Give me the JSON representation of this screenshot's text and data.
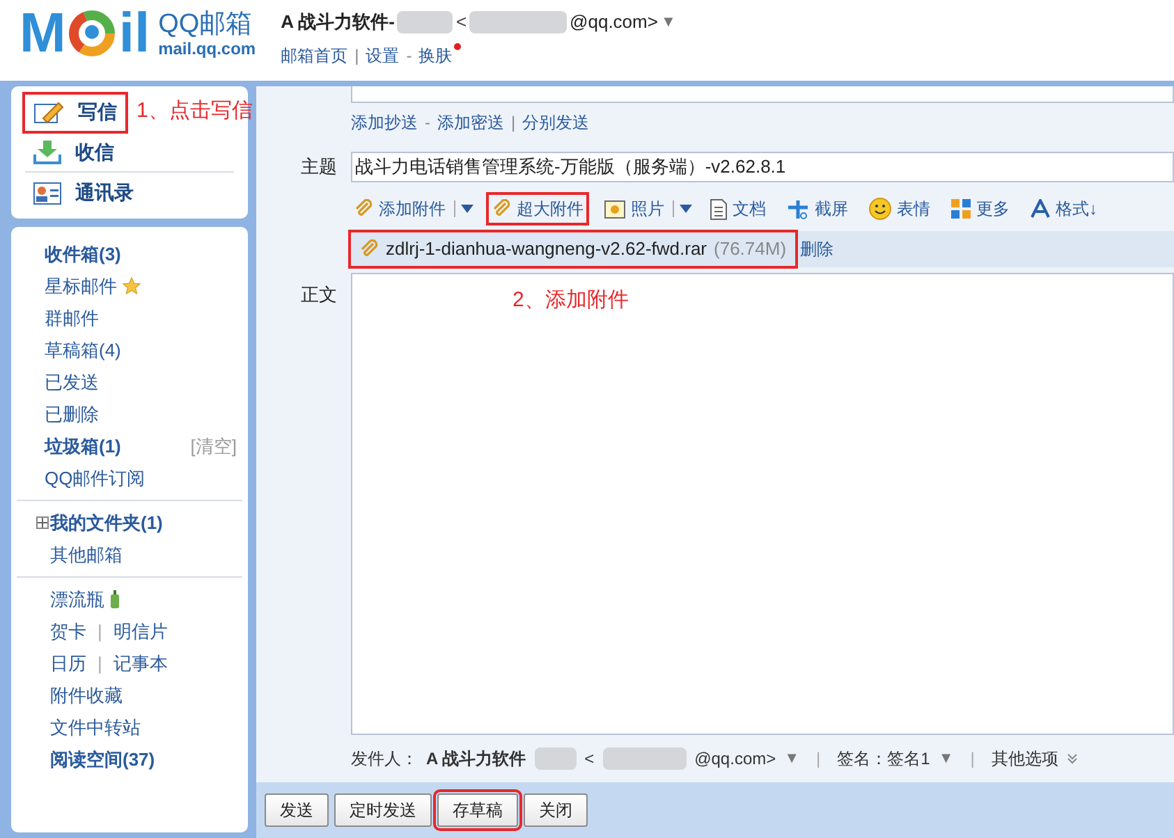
{
  "logo": {
    "mark_start": "M",
    "mark_end": "il",
    "brand": "QQ邮箱",
    "domain": "mail.qq.com"
  },
  "account": {
    "name": "A 战斗力软件-",
    "open_bracket": "<",
    "email_end": "@qq.com>",
    "caret": "▼"
  },
  "top_links": [
    {
      "kind": "link",
      "label": "邮箱首页",
      "badge": false
    },
    {
      "kind": "sep",
      "label": "|"
    },
    {
      "kind": "link",
      "label": "设置",
      "badge": false
    },
    {
      "kind": "sep",
      "label": "-"
    },
    {
      "kind": "link",
      "label": "换肤",
      "badge": true
    }
  ],
  "actions": [
    {
      "label": "写信",
      "highlighted": true
    },
    {
      "label": "收信",
      "highlighted": false
    },
    {
      "label": "通讯录",
      "highlighted": false
    }
  ],
  "annotations": [
    "1、点击写信",
    "2、添加附件"
  ],
  "folder_groups": [
    [
      {
        "kind": "item",
        "label": "收件箱(3)",
        "bold": true
      },
      {
        "kind": "starred",
        "label": "星标邮件",
        "bold": false
      },
      {
        "kind": "item",
        "label": "群邮件",
        "bold": false
      },
      {
        "kind": "item",
        "label": "草稿箱(4)",
        "bold": false
      },
      {
        "kind": "item",
        "label": "已发送",
        "bold": false
      },
      {
        "kind": "item",
        "label": "已删除",
        "bold": false
      },
      {
        "kind": "item",
        "label": "垃圾箱(1)",
        "bold": true,
        "action": "[清空]"
      },
      {
        "kind": "item",
        "label": "QQ邮件订阅",
        "bold": false
      }
    ],
    [
      {
        "kind": "item",
        "label": "我的文件夹(1)",
        "bold": true,
        "expanded": false
      },
      {
        "kind": "item",
        "label": "其他邮箱",
        "bold": false
      }
    ],
    [
      {
        "kind": "bottle",
        "label": "漂流瓶",
        "bold": false
      },
      {
        "kind": "pair",
        "labels": [
          "贺卡",
          "明信片"
        ],
        "sep": "|"
      },
      {
        "kind": "pair",
        "labels": [
          "日历",
          "记事本"
        ],
        "sep": "|"
      },
      {
        "kind": "item",
        "label": "附件收藏",
        "bold": false
      },
      {
        "kind": "item",
        "label": "文件中转站",
        "bold": false
      },
      {
        "kind": "item",
        "label": "阅读空间(37)",
        "bold": true
      }
    ]
  ],
  "compose": {
    "cc_links": [
      {
        "kind": "link",
        "label": "添加抄送"
      },
      {
        "kind": "sep",
        "label": "-"
      },
      {
        "kind": "link",
        "label": "添加密送"
      },
      {
        "kind": "sep",
        "label": "|"
      },
      {
        "kind": "link",
        "label": "分别发送"
      }
    ],
    "subject_label": "主题",
    "subject": "战斗力电话销售管理系统-万能版（服务端）-v2.62.8.1",
    "toolbar": [
      {
        "label": "添加附件",
        "dropdown": true,
        "highlighted": false
      },
      {
        "label": "超大附件",
        "dropdown": false,
        "highlighted": true
      },
      {
        "label": "照片",
        "dropdown": true,
        "highlighted": false
      },
      {
        "label": "文档",
        "dropdown": false,
        "highlighted": false
      },
      {
        "label": "截屏",
        "dropdown": false,
        "highlighted": false
      },
      {
        "label": "表情",
        "dropdown": false,
        "highlighted": false
      },
      {
        "label": "更多",
        "dropdown": false,
        "highlighted": false
      },
      {
        "label": "格式↓",
        "dropdown": false,
        "highlighted": false
      }
    ],
    "attachment": {
      "name": "zdlrj-1-dianhua-wangneng-v2.62-fwd.rar",
      "size": "(76.74M)",
      "delete": "删除",
      "highlighted": true
    },
    "body_label": "正文",
    "sender": {
      "label": "发件人：",
      "name": "A 战斗力软件",
      "open_bracket": "<",
      "email_end": "@qq.com>",
      "caret": "▼",
      "sep": "|",
      "signature": "签名：签名1",
      "signature_caret": "▼",
      "sep2": "|",
      "options": "其他选项"
    }
  },
  "buttons": [
    {
      "label": "发送",
      "highlighted": false
    },
    {
      "label": "定时发送",
      "highlighted": false
    },
    {
      "label": "存草稿",
      "highlighted": true
    },
    {
      "label": "关闭",
      "highlighted": false
    }
  ]
}
